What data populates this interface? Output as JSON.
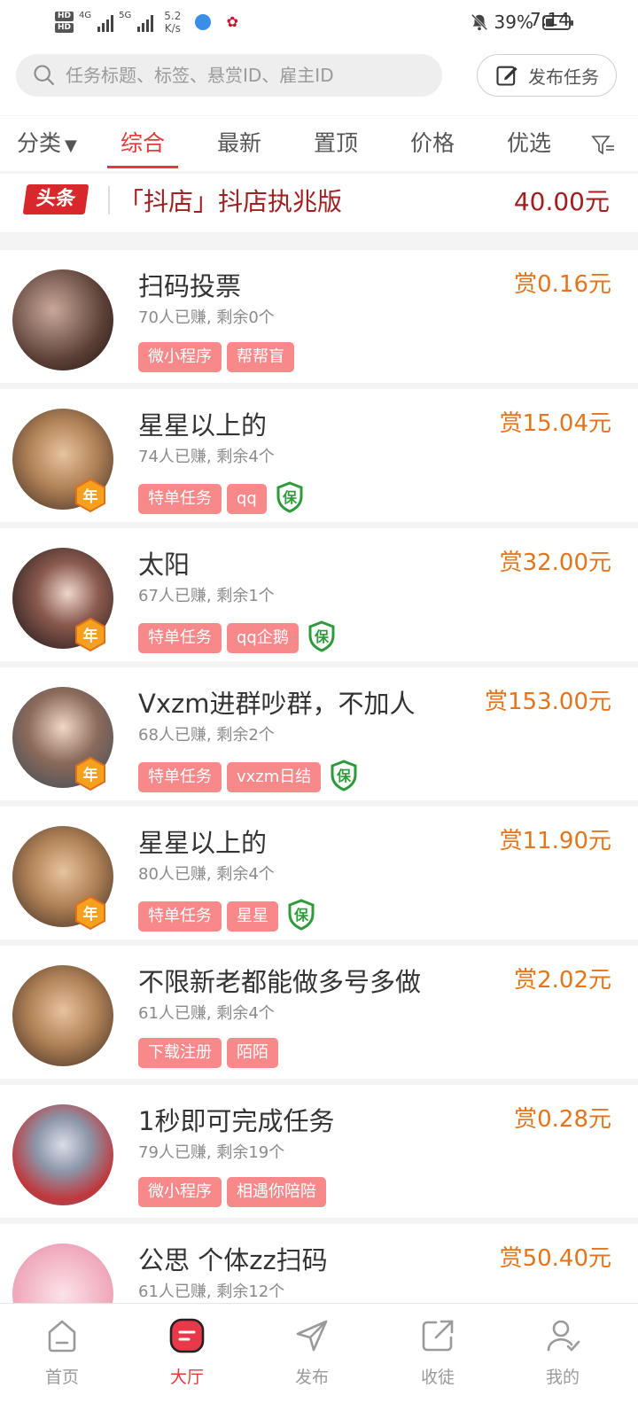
{
  "status_bar": {
    "hd1": "HD",
    "hd2": "HD",
    "net1": "4G",
    "net2": "5G",
    "speed_value": "5.2",
    "speed_unit": "K/s",
    "battery": "39%",
    "battery_level": 0.39,
    "time": "7:14"
  },
  "search": {
    "placeholder": "任务标题、标签、悬赏ID、雇主ID",
    "publish_label": "发布任务"
  },
  "tabs": [
    {
      "label": "分类"
    },
    {
      "label": "综合",
      "active": true
    },
    {
      "label": "最新"
    },
    {
      "label": "置顶"
    },
    {
      "label": "价格"
    },
    {
      "label": "优选"
    }
  ],
  "headline": {
    "badge": "头条",
    "title": "「抖店」抖店执兆版",
    "price": "40.00元"
  },
  "tasks": [
    {
      "title": "扫码投票",
      "stats": "70人已赚, 剩余0个",
      "reward": "赏0.16元",
      "tags": [
        "微小程序",
        "帮帮盲"
      ],
      "guaranteed": false,
      "year_badge": false
    },
    {
      "title": "星星以上的",
      "stats": "74人已赚, 剩余4个",
      "reward": "赏15.04元",
      "tags": [
        "特单任务",
        "qq"
      ],
      "guaranteed": true,
      "year_badge": true
    },
    {
      "title": "太阳",
      "stats": "67人已赚, 剩余1个",
      "reward": "赏32.00元",
      "tags": [
        "特单任务",
        "qq企鹅"
      ],
      "guaranteed": true,
      "year_badge": true
    },
    {
      "title": "Vxzm进群吵群，不加人",
      "stats": "68人已赚, 剩余2个",
      "reward": "赏153.00元",
      "tags": [
        "特单任务",
        "vxzm日结"
      ],
      "guaranteed": true,
      "year_badge": true
    },
    {
      "title": "星星以上的",
      "stats": "80人已赚, 剩余4个",
      "reward": "赏11.90元",
      "tags": [
        "特单任务",
        "星星"
      ],
      "guaranteed": true,
      "year_badge": true
    },
    {
      "title": "不限新老都能做多号多做",
      "stats": "61人已赚, 剩余4个",
      "reward": "赏2.02元",
      "tags": [
        "下载注册",
        "陌陌"
      ],
      "guaranteed": false,
      "year_badge": false
    },
    {
      "title": "1秒即可完成任务",
      "stats": "79人已赚, 剩余19个",
      "reward": "赏0.28元",
      "tags": [
        "微小程序",
        "相遇你陪陪"
      ],
      "guaranteed": false,
      "year_badge": false
    },
    {
      "title": "公思 个体zz扫码",
      "stats": "61人已赚, 剩余12个",
      "reward": "赏50.40元",
      "tags": [],
      "guaranteed": false,
      "year_badge": false
    }
  ],
  "badges": {
    "year": "年",
    "guarantee": "保"
  },
  "bottom_nav": [
    {
      "label": "首页",
      "icon": "home-icon"
    },
    {
      "label": "大厅",
      "icon": "hall-icon",
      "active": true
    },
    {
      "label": "发布",
      "icon": "send-icon"
    },
    {
      "label": "收徒",
      "icon": "share-icon"
    },
    {
      "label": "我的",
      "icon": "profile-icon"
    }
  ],
  "colors": {
    "accent": "#e23a3a",
    "reward": "#e5741b",
    "tag": "#f7898a",
    "guarantee": "#2e9b3a",
    "headline": "#a02020"
  }
}
